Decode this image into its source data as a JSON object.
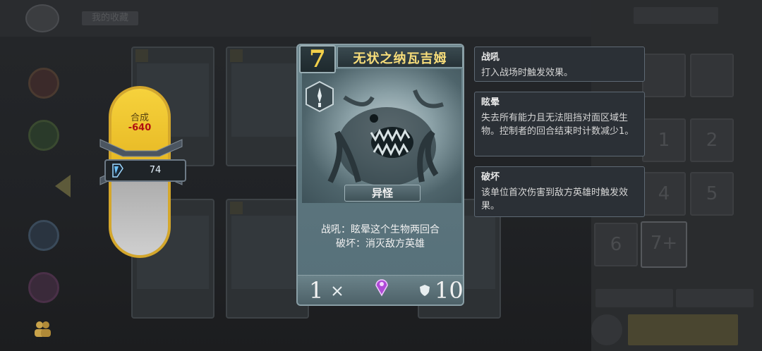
{
  "header": {
    "title": "我的收藏"
  },
  "craft": {
    "label": "合成",
    "cost": "-640",
    "dust_count": "74"
  },
  "card": {
    "cost": "7",
    "name": "无状之纳瓦吉姆",
    "type": "异怪",
    "text_line1": "战吼：眩晕这个生物两回合",
    "text_line2": "破坏：消灭敌方英雄",
    "attack": "1",
    "health": "10",
    "gem_color": "#b04ad8",
    "name_color": "#f7dd7a",
    "cost_color": "#f3d04a"
  },
  "keywords": [
    {
      "title": "战吼",
      "desc": "打入战场时触发效果。"
    },
    {
      "title": "眩晕",
      "desc": "失去所有能力且无法阻挡对面区域生物。控制者的回合结束时计数减少1。"
    },
    {
      "title": "破坏",
      "desc": "该单位首次伤害到敌方英雄时触发效果。"
    }
  ],
  "right_panel": {
    "slots": [
      "1",
      "2",
      "4",
      "5",
      "6",
      "7+"
    ]
  },
  "icons": [
    "back-icon",
    "people-icon",
    "dust-icon",
    "faction-icon",
    "sword-icon",
    "gem-icon",
    "shield-icon"
  ]
}
